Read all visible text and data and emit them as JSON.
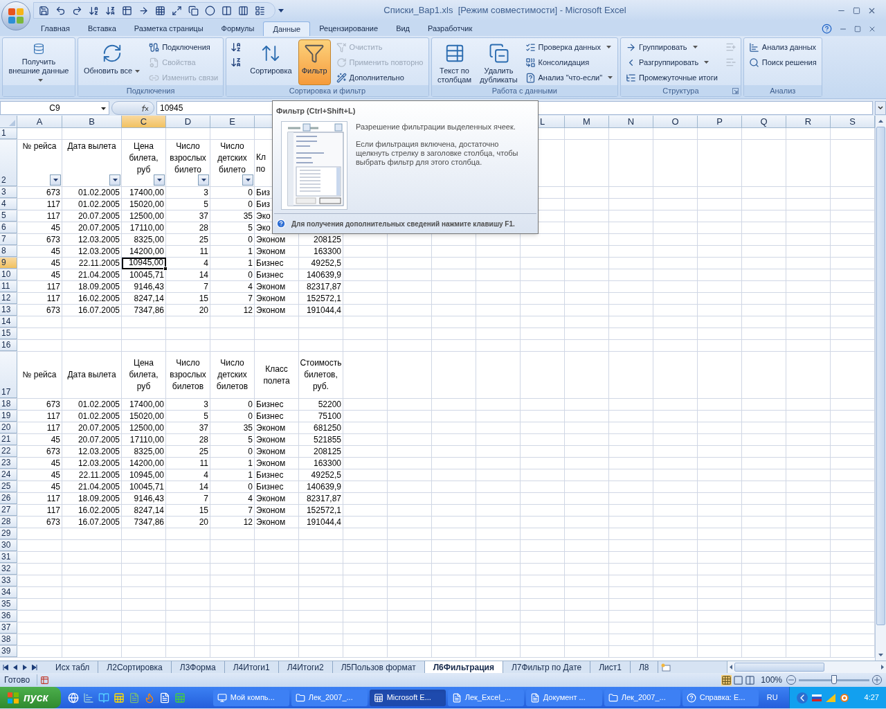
{
  "window": {
    "title": "Списки_Вар1.xls  [Режим совместимости] - Microsoft Excel"
  },
  "ribbon_tabs": [
    {
      "label": "Главная",
      "selected": false
    },
    {
      "label": "Вставка",
      "selected": false
    },
    {
      "label": "Разметка страницы",
      "selected": false
    },
    {
      "label": "Формулы",
      "selected": false
    },
    {
      "label": "Данные",
      "selected": true
    },
    {
      "label": "Рецензирование",
      "selected": false
    },
    {
      "label": "Вид",
      "selected": false
    },
    {
      "label": "Разработчик",
      "selected": false
    }
  ],
  "ribbon_groups": [
    {
      "buttons": [
        {
          "kind": "large",
          "label": "Получить внешние данные",
          "dropdown": true,
          "disabled": false,
          "selected": false
        }
      ]
    },
    {
      "label": "Подключения",
      "buttons": [
        {
          "kind": "large",
          "label": "Обновить все",
          "dropdown": true,
          "disabled": false,
          "selected": false
        },
        {
          "kind": "small",
          "label": "Подключения",
          "dropdown": false,
          "disabled": false,
          "selected": false
        },
        {
          "kind": "small",
          "label": "Свойства",
          "dropdown": false,
          "disabled": true,
          "selected": false
        },
        {
          "kind": "small",
          "label": "Изменить связи",
          "dropdown": false,
          "disabled": true,
          "selected": false
        }
      ]
    },
    {
      "label": "Сортировка и фильтр",
      "buttons": [
        {
          "kind": "icon",
          "disabled": false,
          "selected": false
        },
        {
          "kind": "icon",
          "disabled": false,
          "selected": false
        },
        {
          "kind": "large",
          "label": "Сортировка",
          "dropdown": false,
          "disabled": false,
          "selected": false
        },
        {
          "kind": "large",
          "label": "Фильтр",
          "dropdown": false,
          "disabled": false,
          "selected": true
        },
        {
          "kind": "small",
          "label": "Очистить",
          "dropdown": false,
          "disabled": true,
          "selected": false
        },
        {
          "kind": "small",
          "label": "Применить повторно",
          "dropdown": false,
          "disabled": true,
          "selected": false
        },
        {
          "kind": "small",
          "label": "Дополнительно",
          "dropdown": false,
          "disabled": false,
          "selected": false
        }
      ]
    },
    {
      "label": "Работа с данными",
      "buttons": [
        {
          "kind": "large",
          "label": "Текст по столбцам",
          "dropdown": false,
          "disabled": false,
          "selected": false
        },
        {
          "kind": "large",
          "label": "Удалить дубликаты",
          "dropdown": false,
          "disabled": false,
          "selected": false
        },
        {
          "kind": "small",
          "label": "Проверка данных",
          "dropdown": true,
          "disabled": false,
          "selected": false
        },
        {
          "kind": "small",
          "label": "Консолидация",
          "dropdown": false,
          "disabled": false,
          "selected": false
        },
        {
          "kind": "small",
          "label": "Анализ \"что-если\"",
          "dropdown": true,
          "disabled": false,
          "selected": false
        }
      ]
    },
    {
      "label": "Структура",
      "launcher": true,
      "buttons": [
        {
          "kind": "small",
          "label": "Группировать",
          "dropdown": true,
          "disabled": false,
          "selected": false
        },
        {
          "kind": "small",
          "label": "Разгруппировать",
          "dropdown": true,
          "disabled": false,
          "selected": false
        },
        {
          "kind": "small",
          "label": "Промежуточные итоги",
          "dropdown": false,
          "disabled": false,
          "selected": false
        },
        {
          "kind": "icon",
          "disabled": true,
          "selected": false
        },
        {
          "kind": "icon",
          "disabled": true,
          "selected": false
        }
      ]
    },
    {
      "label": "Анализ",
      "buttons": [
        {
          "kind": "small",
          "label": "Анализ данных",
          "dropdown": false,
          "disabled": false,
          "selected": false
        },
        {
          "kind": "small",
          "label": "Поиск решения",
          "dropdown": false,
          "disabled": false,
          "selected": false
        }
      ]
    }
  ],
  "formula_bar": {
    "name_box": "C9",
    "formula": "10945"
  },
  "columns": [
    {
      "label": "A",
      "selected": false
    },
    {
      "label": "B",
      "selected": false
    },
    {
      "label": "C",
      "selected": true
    },
    {
      "label": "D",
      "selected": false
    },
    {
      "label": "E",
      "selected": false
    },
    {
      "selected": false
    },
    null,
    null,
    null,
    null,
    null,
    {
      "label": "L",
      "selected": false
    },
    {
      "label": "M",
      "selected": false
    },
    {
      "label": "N",
      "selected": false
    },
    {
      "label": "O",
      "selected": false
    },
    {
      "label": "P",
      "selected": false
    },
    {
      "label": "Q",
      "selected": false
    },
    {
      "label": "R",
      "selected": false
    },
    {
      "label": "S",
      "selected": false
    }
  ],
  "rows": [
    {
      "number": "1",
      "kind": "blank",
      "selected": false
    },
    {
      "number": "2",
      "kind": "header",
      "filter": true,
      "selected": false,
      "cells": [
        "№ рейса",
        "Дата вылета",
        "Цена билета, руб",
        "Число взрослых билето",
        "Число детских билето",
        "Кл по"
      ]
    },
    {
      "number": "3",
      "kind": "data",
      "selected": false,
      "cells": [
        "673",
        "01.02.2005",
        "17400,00",
        "3",
        "0",
        "Биз"
      ]
    },
    {
      "number": "4",
      "kind": "data",
      "selected": false,
      "cells": [
        "117",
        "01.02.2005",
        "15020,00",
        "5",
        "0",
        "Биз"
      ]
    },
    {
      "number": "5",
      "kind": "data",
      "selected": false,
      "cells": [
        "117",
        "20.07.2005",
        "12500,00",
        "37",
        "35",
        "Эко"
      ]
    },
    {
      "number": "6",
      "kind": "data",
      "selected": false,
      "cells": [
        "45",
        "20.07.2005",
        "17110,00",
        "28",
        "5",
        "Эко"
      ]
    },
    {
      "number": "7",
      "kind": "data",
      "selected": false,
      "cells": [
        "673",
        "12.03.2005",
        "8325,00",
        "25",
        "0",
        "Эконом",
        "208125"
      ]
    },
    {
      "number": "8",
      "kind": "data",
      "selected": false,
      "cells": [
        "45",
        "12.03.2005",
        "14200,00",
        "11",
        "1",
        "Эконом",
        "163300"
      ]
    },
    {
      "number": "9",
      "kind": "data",
      "selected": true,
      "cells": [
        "45",
        "22.11.2005",
        "10945,00",
        "4",
        "1",
        "Бизнес",
        "49252,5"
      ]
    },
    {
      "number": "10",
      "kind": "data",
      "selected": false,
      "cells": [
        "45",
        "21.04.2005",
        "10045,71",
        "14",
        "0",
        "Бизнес",
        "140639,9"
      ]
    },
    {
      "number": "11",
      "kind": "data",
      "selected": false,
      "cells": [
        "117",
        "18.09.2005",
        "9146,43",
        "7",
        "4",
        "Эконом",
        "82317,87"
      ]
    },
    {
      "number": "12",
      "kind": "data",
      "selected": false,
      "cells": [
        "117",
        "16.02.2005",
        "8247,14",
        "15",
        "7",
        "Эконом",
        "152572,1"
      ]
    },
    {
      "number": "13",
      "kind": "data",
      "selected": false,
      "cells": [
        "673",
        "16.07.2005",
        "7347,86",
        "20",
        "12",
        "Эконом",
        "191044,4"
      ]
    },
    {
      "number": "14",
      "kind": "blank",
      "selected": false
    },
    {
      "number": "15",
      "kind": "blank",
      "selected": false
    },
    {
      "number": "16",
      "kind": "blank",
      "selected": false
    },
    {
      "number": "17",
      "kind": "header",
      "filter": false,
      "selected": false,
      "cells": [
        "№ рейса",
        "Дата вылета",
        "Цена билета, руб",
        "Число взрослых билетов",
        "Число детских билетов",
        "Класс полета",
        "Стоимость билетов, руб."
      ]
    },
    {
      "number": "18",
      "kind": "data",
      "selected": false,
      "cells": [
        "673",
        "01.02.2005",
        "17400,00",
        "3",
        "0",
        "Бизнес",
        "52200"
      ]
    },
    {
      "number": "19",
      "kind": "data",
      "selected": false,
      "cells": [
        "117",
        "01.02.2005",
        "15020,00",
        "5",
        "0",
        "Бизнес",
        "75100"
      ]
    },
    {
      "number": "20",
      "kind": "data",
      "selected": false,
      "cells": [
        "117",
        "20.07.2005",
        "12500,00",
        "37",
        "35",
        "Эконом",
        "681250"
      ]
    },
    {
      "number": "21",
      "kind": "data",
      "selected": false,
      "cells": [
        "45",
        "20.07.2005",
        "17110,00",
        "28",
        "5",
        "Эконом",
        "521855"
      ]
    },
    {
      "number": "22",
      "kind": "data",
      "selected": false,
      "cells": [
        "673",
        "12.03.2005",
        "8325,00",
        "25",
        "0",
        "Эконом",
        "208125"
      ]
    },
    {
      "number": "23",
      "kind": "data",
      "selected": false,
      "cells": [
        "45",
        "12.03.2005",
        "14200,00",
        "11",
        "1",
        "Эконом",
        "163300"
      ]
    },
    {
      "number": "24",
      "kind": "data",
      "selected": false,
      "cells": [
        "45",
        "22.11.2005",
        "10945,00",
        "4",
        "1",
        "Бизнес",
        "49252,5"
      ]
    },
    {
      "number": "25",
      "kind": "data",
      "selected": false,
      "cells": [
        "45",
        "21.04.2005",
        "10045,71",
        "14",
        "0",
        "Бизнес",
        "140639,9"
      ]
    },
    {
      "number": "26",
      "kind": "data",
      "selected": false,
      "cells": [
        "117",
        "18.09.2005",
        "9146,43",
        "7",
        "4",
        "Эконом",
        "82317,87"
      ]
    },
    {
      "number": "27",
      "kind": "data",
      "selected": false,
      "cells": [
        "117",
        "16.02.2005",
        "8247,14",
        "15",
        "7",
        "Эконом",
        "152572,1"
      ]
    },
    {
      "number": "28",
      "kind": "data",
      "selected": false,
      "cells": [
        "673",
        "16.07.2005",
        "7347,86",
        "20",
        "12",
        "Эконом",
        "191044,4"
      ]
    },
    {
      "number": "29",
      "kind": "blank",
      "selected": false
    },
    {
      "number": "30",
      "kind": "blank",
      "selected": false
    },
    {
      "number": "31",
      "kind": "blank",
      "selected": false
    },
    {
      "number": "32",
      "kind": "blank",
      "selected": false
    },
    {
      "number": "33",
      "kind": "blank",
      "selected": false
    },
    {
      "number": "34",
      "kind": "blank",
      "selected": false
    },
    {
      "number": "35",
      "kind": "blank",
      "selected": false
    },
    {
      "number": "36",
      "kind": "blank",
      "selected": false
    },
    {
      "number": "37",
      "kind": "blank",
      "selected": false
    },
    {
      "number": "38",
      "kind": "blank",
      "selected": false
    },
    {
      "number": "39",
      "kind": "blank",
      "selected": false
    }
  ],
  "tooltip": {
    "title": "Фильтр (Ctrl+Shift+L)",
    "paragraphs": [
      "Разрешение фильтрации выделенных ячеек.",
      "Если фильтрация включена, достаточно щелкнуть стрелку в заголовке столбца, чтобы выбрать фильтр для этого столбца."
    ],
    "help": "Для получения дополнительных сведений нажмите клавишу F1."
  },
  "sheet_tabs": [
    {
      "label": "Исх табл",
      "selected": false
    },
    {
      "label": "Л2Сортировка",
      "selected": false
    },
    {
      "label": "Л3Форма",
      "selected": false
    },
    {
      "label": "Л4Итоги1",
      "selected": false
    },
    {
      "label": "Л4Итоги2",
      "selected": false
    },
    {
      "label": "Л5Пользов формат",
      "selected": false
    },
    {
      "label": "Л6Фильтрация",
      "selected": true
    },
    {
      "label": "Л7Фильтр по Дате",
      "selected": false
    },
    {
      "label": "Лист1",
      "selected": false
    },
    {
      "label": "Л8",
      "selected": false
    }
  ],
  "status_bar": {
    "status": "Готово",
    "zoom": "100%",
    "zoom_slider": {
      "level": 0.5
    }
  },
  "taskbar": {
    "start": "пуск",
    "tasks": [
      {
        "label": "Мой компь...",
        "selected": false
      },
      {
        "label": "Лек_2007_...",
        "selected": false
      },
      {
        "label": "Microsoft E...",
        "selected": true
      },
      {
        "label": "Лек_Excel_...",
        "selected": false
      },
      {
        "label": "Документ ...",
        "selected": false
      },
      {
        "label": "Лек_2007_...",
        "selected": false
      },
      {
        "label": "Справка: E...",
        "selected": false
      }
    ],
    "language": "RU",
    "clock": "4:27"
  }
}
